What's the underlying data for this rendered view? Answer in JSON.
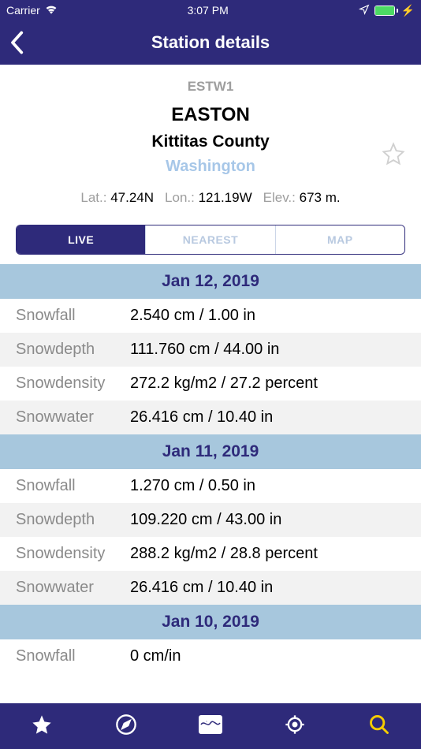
{
  "status": {
    "carrier": "Carrier",
    "time": "3:07 PM"
  },
  "nav": {
    "title": "Station details"
  },
  "station": {
    "id": "ESTW1",
    "name": "EASTON",
    "county": "Kittitas County",
    "state": "Washington",
    "lat_label": "Lat.:",
    "lat_value": "47.24N",
    "lon_label": "Lon.:",
    "lon_value": "121.19W",
    "elev_label": "Elev.:",
    "elev_value": "673 m."
  },
  "segments": {
    "live": "LIVE",
    "nearest": "NEAREST",
    "map": "MAP"
  },
  "dates": [
    {
      "header": "Jan 12, 2019",
      "rows": [
        {
          "label": "Snowfall",
          "value": "2.540 cm / 1.00 in"
        },
        {
          "label": "Snowdepth",
          "value": "111.760 cm / 44.00 in"
        },
        {
          "label": "Snowdensity",
          "value": "272.2 kg/m2 / 27.2 percent"
        },
        {
          "label": "Snowwater",
          "value": "26.416 cm / 10.40 in"
        }
      ]
    },
    {
      "header": "Jan 11, 2019",
      "rows": [
        {
          "label": "Snowfall",
          "value": "1.270 cm / 0.50 in"
        },
        {
          "label": "Snowdepth",
          "value": "109.220 cm / 43.00 in"
        },
        {
          "label": "Snowdensity",
          "value": "288.2 kg/m2 / 28.8 percent"
        },
        {
          "label": "Snowwater",
          "value": "26.416 cm / 10.40 in"
        }
      ]
    },
    {
      "header": "Jan 10, 2019",
      "rows": [
        {
          "label": "Snowfall",
          "value": "0 cm/in"
        }
      ]
    }
  ]
}
